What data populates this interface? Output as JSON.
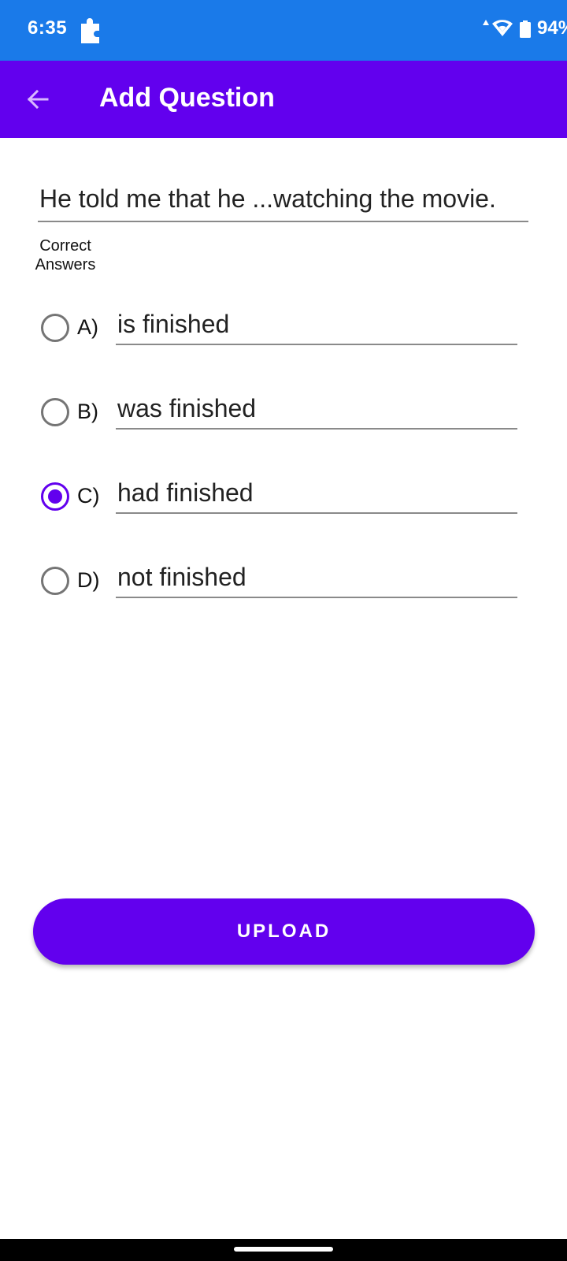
{
  "status_bar": {
    "time": "6:35",
    "battery": "94%",
    "icons": [
      "puzzle-icon",
      "data-arrow-icon",
      "wifi-icon",
      "battery-icon"
    ],
    "color": "#1a7ae9"
  },
  "app_bar": {
    "title": "Add Question",
    "back_icon": "arrow-left-icon",
    "color": "#6200ee"
  },
  "question": {
    "value": "He told me that he ...watching the movie."
  },
  "correct_answers_label": "Correct Answers",
  "options": [
    {
      "letter": "A)",
      "value": "is finished",
      "selected": false
    },
    {
      "letter": "B)",
      "value": "was finished",
      "selected": false
    },
    {
      "letter": "C)",
      "value": "had finished",
      "selected": true
    },
    {
      "letter": "D)",
      "value": "not finished",
      "selected": false
    }
  ],
  "upload_label": "UPLOAD",
  "accent_color": "#6200ee"
}
